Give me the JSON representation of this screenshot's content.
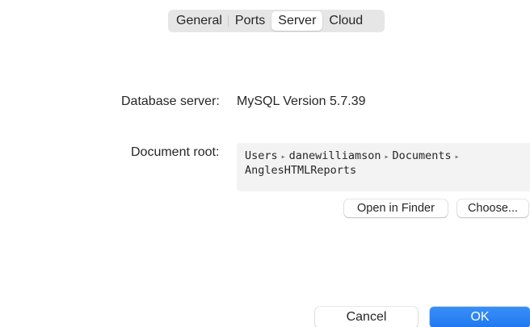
{
  "tabs": {
    "items": [
      {
        "label": "General"
      },
      {
        "label": "Ports"
      },
      {
        "label": "Server"
      },
      {
        "label": "Cloud"
      }
    ],
    "selected": "Server"
  },
  "server": {
    "database_label": "Database server:",
    "database_value": "MySQL Version 5.7.39",
    "docroot_label": "Document root:",
    "path_parts": [
      "Users",
      "danewilliamson",
      "Documents",
      "AnglesHTMLReports"
    ],
    "path_separator": "▸"
  },
  "buttons": {
    "open_in_finder": "Open in Finder",
    "choose": "Choose...",
    "cancel": "Cancel",
    "ok": "OK"
  },
  "colors": {
    "accent": "#2b84f5",
    "path_background": "#f3f3f3"
  }
}
